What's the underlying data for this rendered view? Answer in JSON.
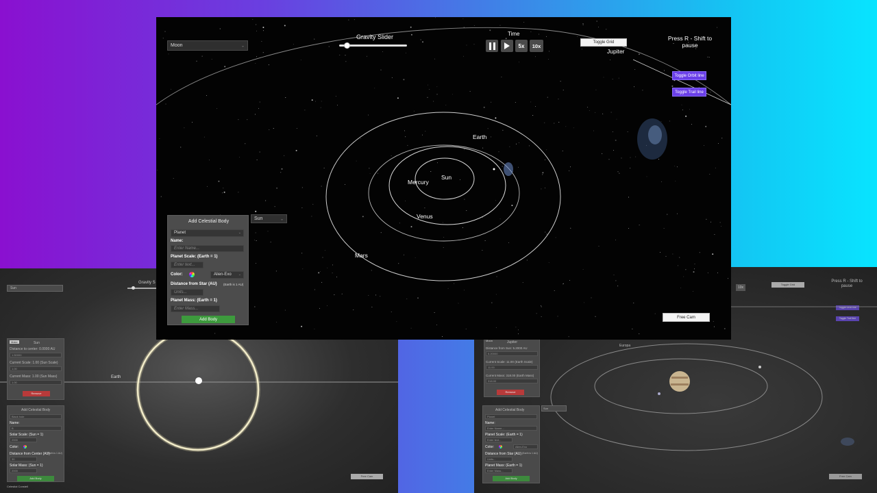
{
  "top_controls": {
    "body_select": "Moon",
    "gravity_label": "Gravity Slider",
    "gravity_level": 0.12,
    "time_label": "Time",
    "time_buttons": [
      "5x",
      "10x"
    ],
    "toggle_grid": "Toggle Grid",
    "pause_hint": "Press R - Shift to pause",
    "toggle_orbit": "Toggle Orbit line",
    "toggle_trail": "Toggle Trail line",
    "free_cam": "Free Cam"
  },
  "bodies": {
    "jupiter": "Jupiter",
    "earth": "Earth",
    "sun": "Sun",
    "mercury": "Mercury",
    "venus": "Venus",
    "mars": "Mars"
  },
  "focus_select": "Sun",
  "add_panel": {
    "title": "Add Celestial Body",
    "type": "Planet",
    "name_label": "Name:",
    "name_placeholder": "Enter Name...",
    "scale_label": "Planet Scale: (Earth = 1)",
    "scale_placeholder": "Enter text...",
    "color_label": "Color:",
    "texture": "Alien-Exo",
    "distance_label": "Distance from Star (AU)",
    "distance_note": "(Earth is 1 AU)",
    "distance_placeholder": "Units...",
    "mass_label": "Planet Mass: (Earth = 1)",
    "mass_placeholder": "Enter Mass...",
    "add_button": "Add Body"
  },
  "bg_left": {
    "select": "Sun",
    "gravity_partial": "Gravity S",
    "info_tag": "Make",
    "info_title": "Sun",
    "distance": "Distance to center: 0.0000 AU",
    "distance_val": "1.50000",
    "scale": "Current Scale: 1.00 (Sun Scale)",
    "scale_val": "1.00",
    "mass": "Current Mass: 1.00 (Sun Mass)",
    "mass_val": "1.00",
    "remove": "Remove",
    "add_title": "Add Celestial Body",
    "add_type": "Black hole",
    "name": "Name:",
    "name_val": "B",
    "solar_scale": "Solar Scale: (Sun = 1)",
    "solar_scale_val": "2000",
    "color": "Color:",
    "dist_center": "Distance from Center (AU)",
    "dist_note": "(Earth is 1 AU)",
    "dist_val": "30",
    "solar_mass": "Solar Mass: (Sun = 1)",
    "solar_mass_val": "2000",
    "add_btn": "Add Body",
    "earth": "Earth",
    "free_cam": "Free Cam",
    "footer": "Celestial Constell"
  },
  "bg_right": {
    "toggle_grid": "Toggle Grid",
    "pause_hint": "Press R - Shift to pause",
    "toggle_orbit": "Toggle Orbit line",
    "toggle_trail": "Toggle Trail line",
    "time_btn": "10x",
    "info_tag": "Moon",
    "info_title": "Jupiter",
    "distance": "Distance from Sun: 5.2000 AU",
    "distance_val": "5.20000",
    "scale": "Current Scale: 11.00 (Earth Scale)",
    "scale_val": "11.00",
    "mass": "Current Mass: 318.00 (Earth Mass)",
    "mass_val": "318.00",
    "remove": "Remove",
    "europa": "Europa",
    "focus": "Sun",
    "add_title": "Add Celestial Body",
    "add_type": "Planet",
    "name": "Name:",
    "name_ph": "Enter Name...",
    "scale_label": "Planet Scale: (Earth = 1)",
    "scale_ph": "Enter text...",
    "color": "Color:",
    "texture": "Alien-Exo",
    "dist_label": "Distance from Star (AU)",
    "dist_note": "(Earth is 1 AU)",
    "dist_ph": "Units...",
    "mass_label": "Planet Mass: (Earth = 1)",
    "mass_ph": "Enter Mass...",
    "add_btn": "Add Body",
    "free_cam": "Free Cam"
  },
  "colors": {
    "accent_purple": "#6a3fe8",
    "add_green": "#3d9a3d",
    "remove_red": "#b83a3a"
  }
}
